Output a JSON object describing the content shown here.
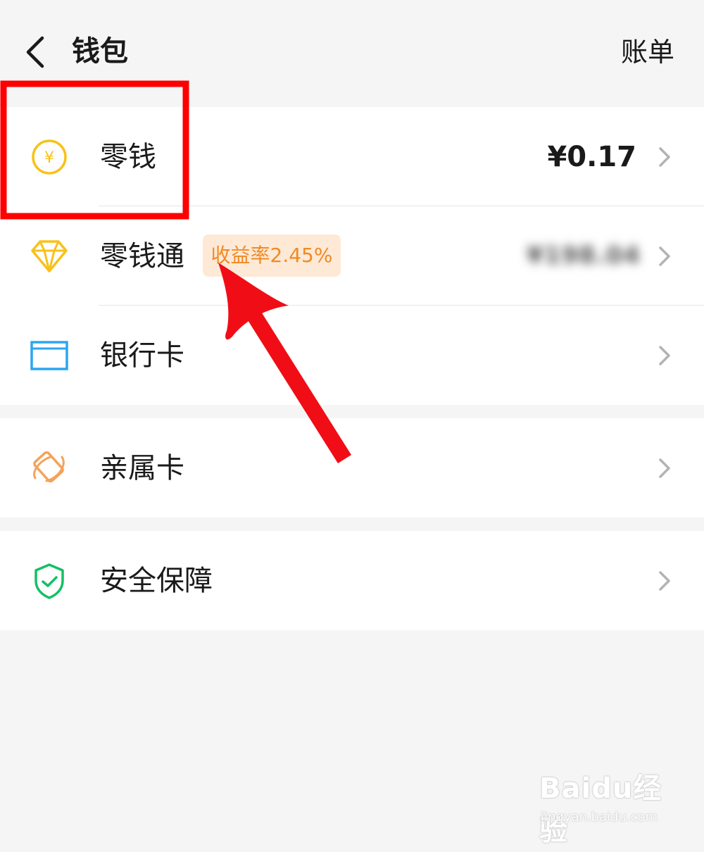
{
  "header": {
    "back_icon": "chevron-left-icon",
    "title": "钱包",
    "bill_label": "账单"
  },
  "wallet_items": [
    {
      "icon": "yuan-coin-icon",
      "label": "零钱",
      "value": "¥0.17"
    },
    {
      "icon": "diamond-icon",
      "label": "零钱通",
      "badge": "收益率2.45%",
      "value_obscured": "¥198.04"
    },
    {
      "icon": "bank-card-icon",
      "label": "银行卡"
    }
  ],
  "family_card": {
    "icon": "family-card-icon",
    "label": "亲属卡"
  },
  "security": {
    "icon": "shield-check-icon",
    "label": "安全保障"
  },
  "annotations": {
    "highlight_color": "#ff0000",
    "arrow_color": "#f00d16"
  },
  "colors": {
    "coin": "#f7c21a",
    "diamond": "#f7c21a",
    "bank_card": "#2aa6f2",
    "family_card": "#f4a35a",
    "shield": "#14c065",
    "badge_bg": "#fde9d6",
    "badge_text": "#f08a24"
  },
  "watermark": {
    "brand": "Baidu经验",
    "url": "jingyan.baidu.com"
  }
}
